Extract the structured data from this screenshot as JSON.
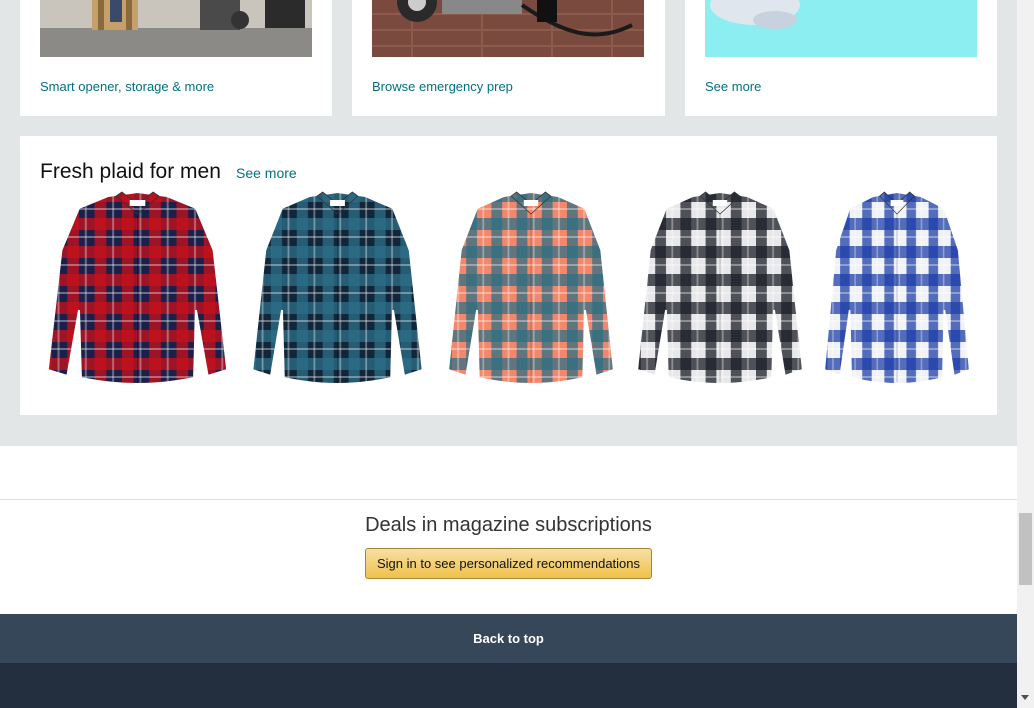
{
  "top_cards": [
    {
      "link": "Smart opener, storage & more",
      "image": "garage-storage-image"
    },
    {
      "link": "Browse emergency prep",
      "image": "generator-wheel-image"
    },
    {
      "link": "See more",
      "image": "teal-product-image"
    }
  ],
  "plaid": {
    "title": "Fresh plaid for men",
    "see_more": "See more",
    "shirts": [
      {
        "name": "red-navy-plaid-shirt",
        "base": "#1c1f4a",
        "stripe": "#c8101a"
      },
      {
        "name": "navy-teal-plaid-shirt",
        "base": "#12263a",
        "stripe": "#2c6f88"
      },
      {
        "name": "coral-teal-plaid-shirt",
        "base": "#f3876b",
        "stripe": "#2e6e83"
      },
      {
        "name": "black-white-plaid-shirt",
        "base": "#e8e8ea",
        "stripe": "#1b1e26"
      },
      {
        "name": "blue-white-plaid-shirt",
        "base": "#f0f2f8",
        "stripe": "#1f3fa8"
      }
    ]
  },
  "deals": {
    "title": "Deals in magazine subscriptions",
    "button": "Sign in to see personalized recommendations"
  },
  "back_to_top": "Back to top"
}
